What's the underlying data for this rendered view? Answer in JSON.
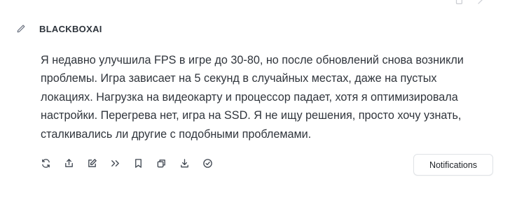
{
  "message": {
    "author": "BLACKBOXAI",
    "edit_icon": "pencil-icon",
    "text": "Я недавно улучшила FPS в игре до 30-80, но после обновлений снова возникли проблемы. Игра зависает на 5 секунд в случайных местах, даже на пустых локациях. Нагрузка на видеокарту и процессор падает, хотя я оптимизировала настройки. Перегрева нет, игра на SSD. Я не ищу решения, просто хочу узнать, сталкивались ли другие с подобными проблемами."
  },
  "toolbar": {
    "icons": [
      "regenerate-icon",
      "share-icon",
      "edit-icon",
      "continue-icon",
      "bookmark-icon",
      "copy-icon",
      "download-icon",
      "check-circle-icon"
    ]
  },
  "notifications_button": {
    "label": "Notifications"
  },
  "colors": {
    "text": "#30353c",
    "icon": "#3f4650",
    "border": "#dfe2e6"
  }
}
